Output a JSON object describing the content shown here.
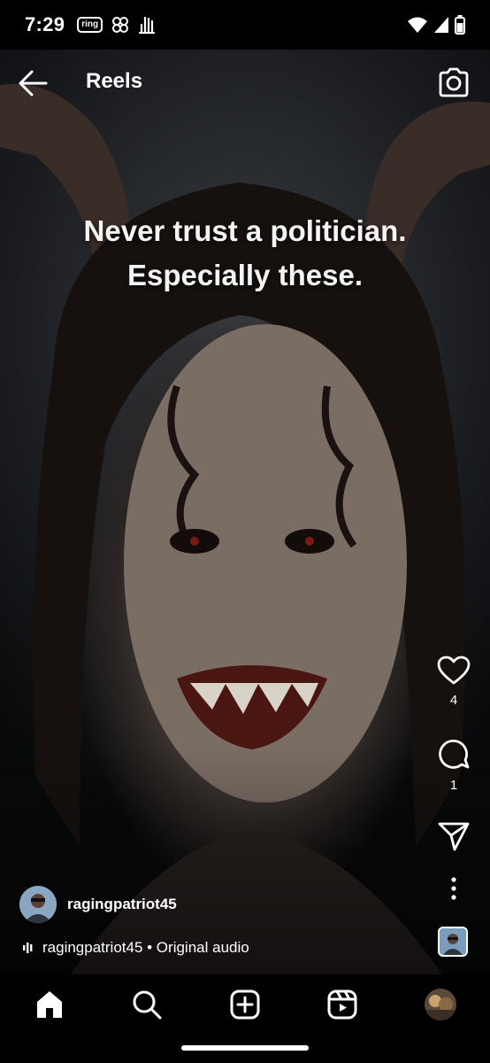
{
  "status_bar": {
    "time": "7:29",
    "ring_badge": "ring",
    "notification_icons": [
      "ring-app-icon",
      "pinwheel-icon",
      "hand-icon"
    ],
    "system_icons": [
      "wifi-icon",
      "signal-icon",
      "battery-icon"
    ]
  },
  "header": {
    "title": "Reels",
    "back_icon": "arrow-left-icon",
    "camera_icon": "camera-icon"
  },
  "caption": {
    "line1": "Never trust a politician.",
    "line2": "Especially these."
  },
  "actions": {
    "likes": "4",
    "comments": "1",
    "icons": [
      "heart-icon",
      "comment-icon",
      "share-icon",
      "more-icon"
    ]
  },
  "author": {
    "username": "ragingpatriot45"
  },
  "audio": {
    "text": "ragingpatriot45 • Original audio"
  },
  "nav": {
    "items": [
      "home-icon",
      "search-icon",
      "create-icon",
      "reels-icon",
      "profile-avatar"
    ]
  },
  "colors": {
    "background": "#000000",
    "text": "#ffffff"
  }
}
